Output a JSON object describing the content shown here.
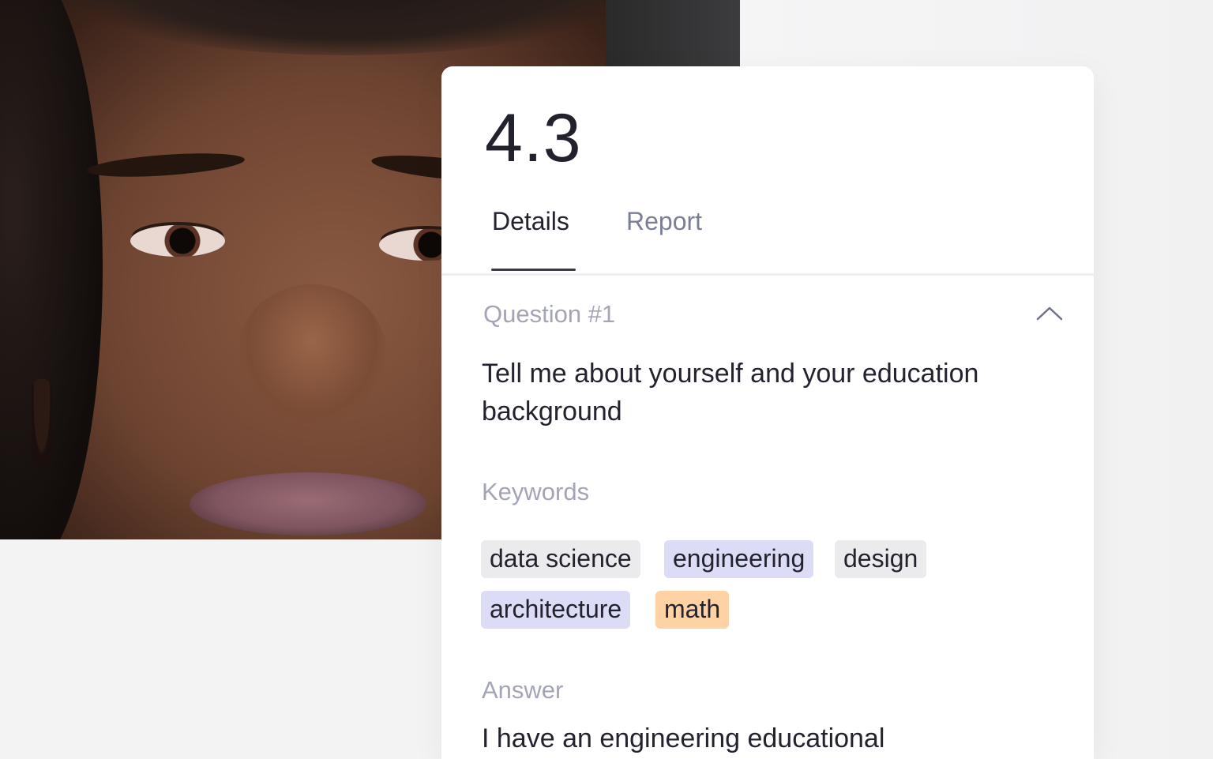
{
  "score": "4.3",
  "tabs": [
    {
      "label": "Details",
      "active": true
    },
    {
      "label": "Report",
      "active": false
    }
  ],
  "question": {
    "header": "Question #1",
    "text": "Tell me about yourself and your education background",
    "expanded": true
  },
  "keywords": {
    "label": "Keywords",
    "items": [
      {
        "text": "data science",
        "color": "#ebebed"
      },
      {
        "text": "engineering",
        "color": "#dcdcf6"
      },
      {
        "text": "design",
        "color": "#ebebed"
      },
      {
        "text": "architecture",
        "color": "#dcdcf6"
      },
      {
        "text": "math",
        "color": "#ffd2a5"
      }
    ]
  },
  "answer": {
    "label": "Answer",
    "text": "I have an engineering educational"
  },
  "icons": {
    "collapse": "chevron-up-icon"
  }
}
